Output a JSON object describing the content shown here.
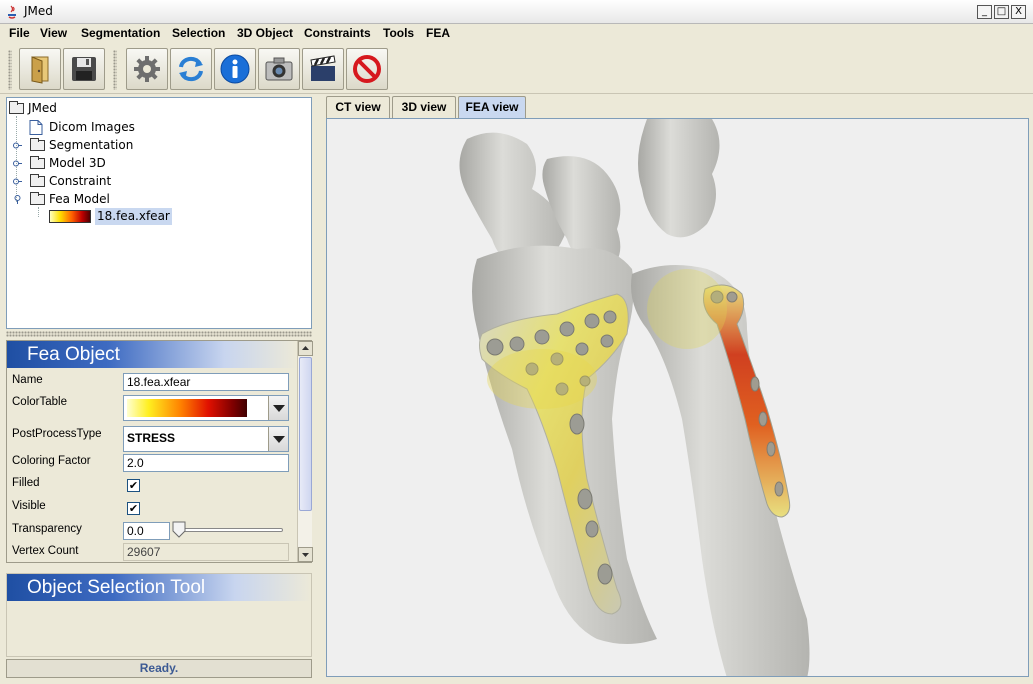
{
  "window": {
    "title": "JMed",
    "controls": {
      "minimize": "_",
      "maximize": "□",
      "close": "X"
    }
  },
  "menubar": {
    "items": [
      "File",
      "View",
      "Segmentation",
      "Selection",
      "3D Object",
      "Constraints",
      "Tools",
      "FEA"
    ]
  },
  "toolbar": {
    "buttons": [
      "open-icon",
      "save-icon",
      "settings-icon",
      "refresh-icon",
      "info-icon",
      "camera-icon",
      "clapperboard-icon",
      "stop-icon"
    ]
  },
  "tree": {
    "root": "JMed",
    "items": [
      {
        "label": "Dicom Images",
        "icon": "document-icon"
      },
      {
        "label": "Segmentation",
        "icon": "folder-icon"
      },
      {
        "label": "Model 3D",
        "icon": "folder-icon"
      },
      {
        "label": "Constraint",
        "icon": "folder-icon"
      },
      {
        "label": "Fea Model",
        "icon": "folder-icon"
      }
    ],
    "fea_child": "18.fea.xfear"
  },
  "fea_object": {
    "title": "Fea Object",
    "name_label": "Name",
    "name_value": "18.fea.xfear",
    "colortable_label": "ColorTable",
    "postprocess_label": "PostProcessType",
    "postprocess_value": "STRESS",
    "coloring_label": "Coloring Factor",
    "coloring_value": "2.0",
    "filled_label": "Filled",
    "filled_value": true,
    "visible_label": "Visible",
    "visible_value": true,
    "transparency_label": "Transparency",
    "transparency_value": "0.0",
    "vertex_label": "Vertex Count",
    "vertex_value": "29607"
  },
  "selection_tool": {
    "title": "Object Selection Tool"
  },
  "status": {
    "text": "Ready."
  },
  "tabs": {
    "items": [
      "CT view",
      "3D view",
      "FEA view"
    ],
    "active": "FEA view"
  },
  "colors": {
    "accent": "#1f4fa3",
    "stress_low": "#ffff80",
    "stress_high": "#cc2200",
    "bone": "#d4d4d0"
  }
}
